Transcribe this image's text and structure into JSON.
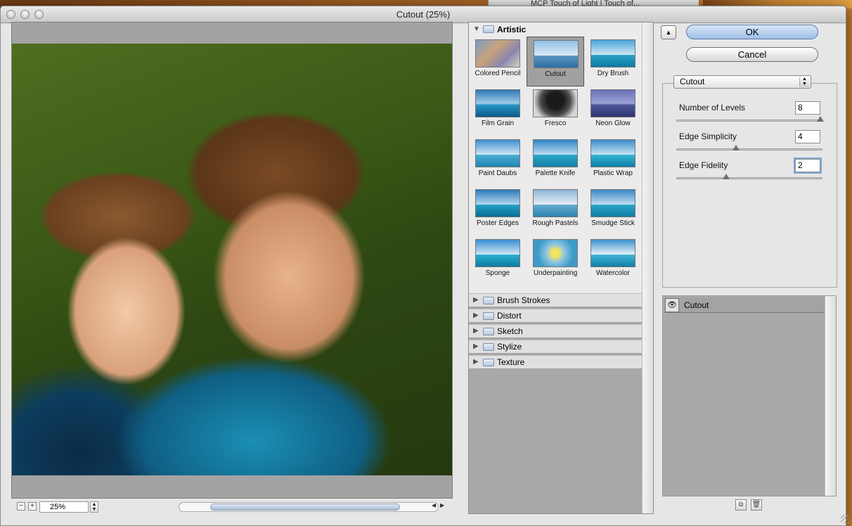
{
  "background": {
    "window_title": "MCP Touch of Light | Touch of..."
  },
  "dialog": {
    "title": "Cutout (25%)"
  },
  "preview": {
    "zoom": "25%",
    "zoom_out": "−",
    "zoom_in": "+"
  },
  "gallery": {
    "open_category": "Artistic",
    "filters": [
      {
        "label": "Colored Pencil"
      },
      {
        "label": "Cutout"
      },
      {
        "label": "Dry Brush"
      },
      {
        "label": "Film Grain"
      },
      {
        "label": "Fresco"
      },
      {
        "label": "Neon Glow"
      },
      {
        "label": "Paint Daubs"
      },
      {
        "label": "Palette Knife"
      },
      {
        "label": "Plastic Wrap"
      },
      {
        "label": "Poster Edges"
      },
      {
        "label": "Rough Pastels"
      },
      {
        "label": "Smudge Stick"
      },
      {
        "label": "Sponge"
      },
      {
        "label": "Underpainting"
      },
      {
        "label": "Watercolor"
      }
    ],
    "selected_filter": "Cutout",
    "categories": [
      "Brush Strokes",
      "Distort",
      "Sketch",
      "Stylize",
      "Texture"
    ]
  },
  "buttons": {
    "ok": "OK",
    "cancel": "Cancel"
  },
  "settings": {
    "filter_select": "Cutout",
    "params": [
      {
        "label": "Number of Levels",
        "value": "8",
        "level": 1.0
      },
      {
        "label": "Edge Simplicity",
        "value": "4",
        "level": 0.4
      },
      {
        "label": "Edge Fidelity",
        "value": "2",
        "level": 0.33
      }
    ]
  },
  "layers": {
    "items": [
      {
        "label": "Cutout",
        "visible": true
      }
    ]
  },
  "colors": {
    "ok_button": "#9fbfe6",
    "selected_thumb": "#a0a0a0"
  }
}
